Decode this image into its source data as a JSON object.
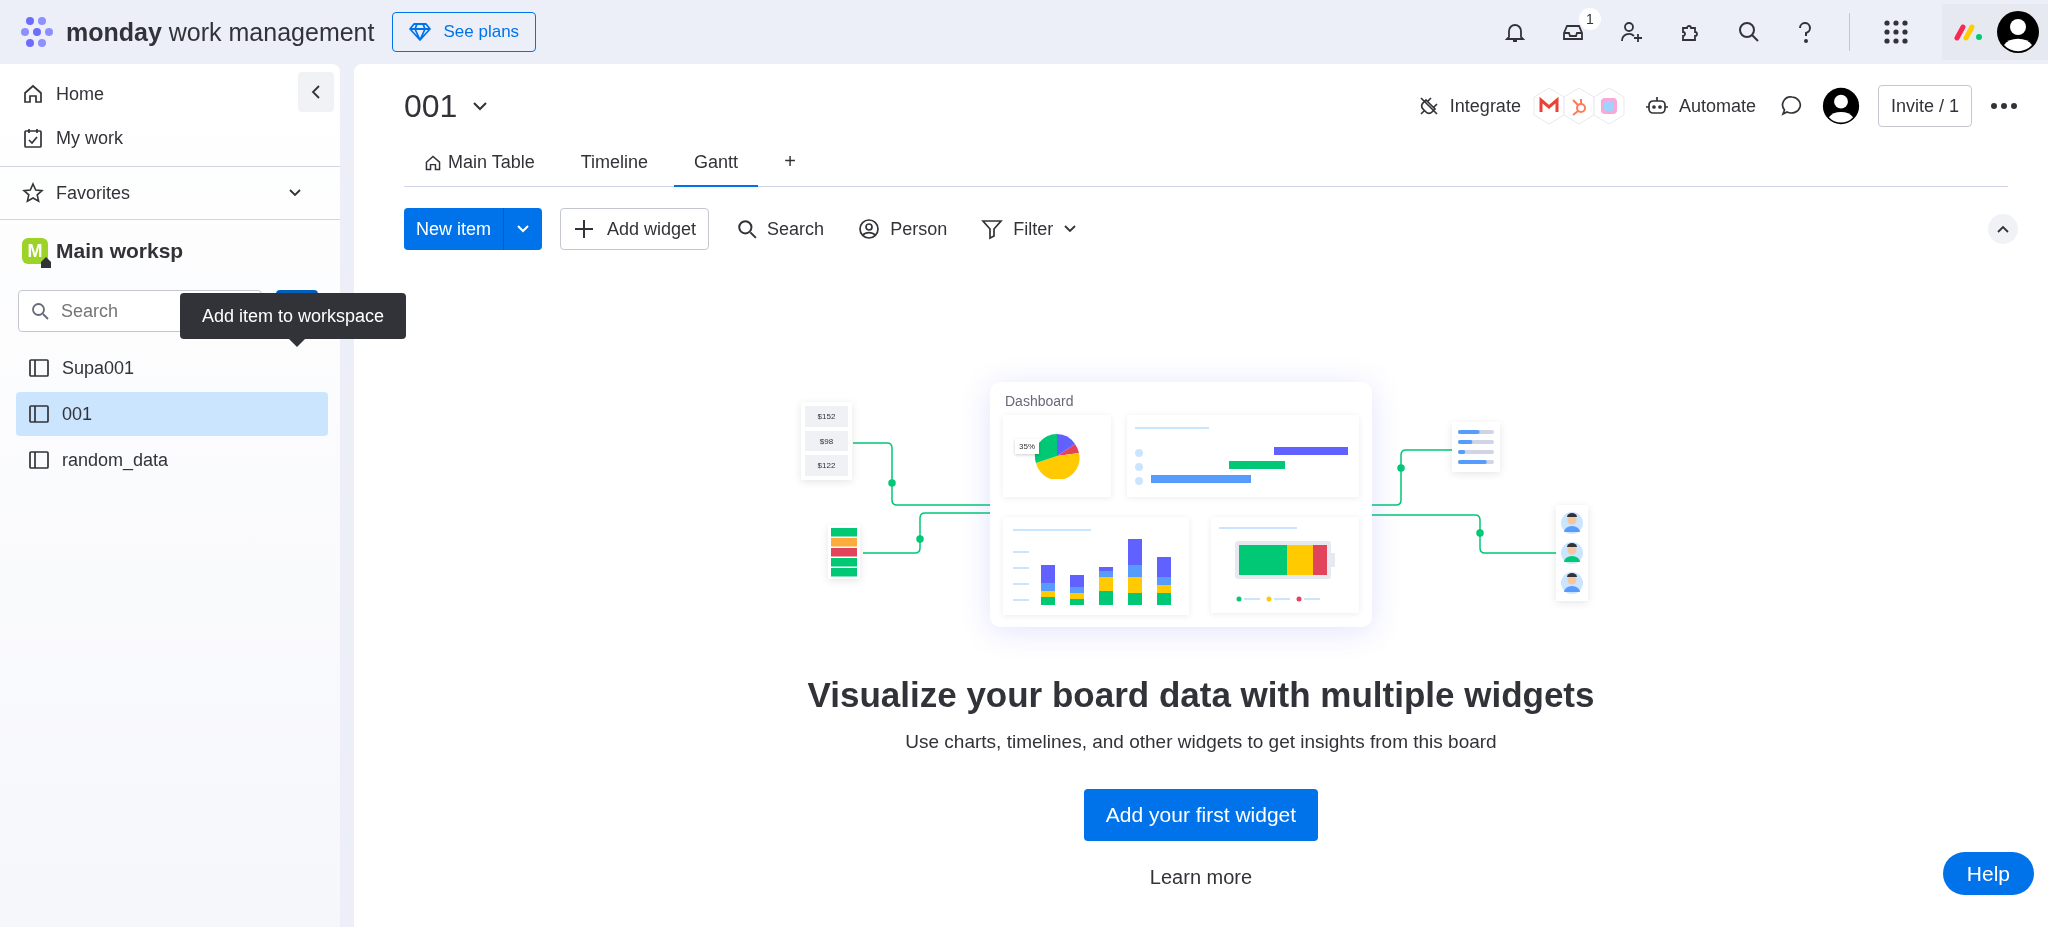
{
  "top_bar": {
    "logo_bold": "monday",
    "logo_rest": "work management",
    "plans_button": "See plans",
    "inbox_badge": "1"
  },
  "sidebar": {
    "nav": [
      {
        "label": "Home",
        "kind": "home"
      },
      {
        "label": "My work",
        "kind": "mywork"
      }
    ],
    "favorites": "Favorites",
    "workspace": {
      "initial": "M",
      "name": "Main worksp"
    },
    "search": {
      "placeholder": "Search"
    },
    "tooltip": "Add item to workspace",
    "boards": [
      {
        "label": "Supa001",
        "selected": false
      },
      {
        "label": "001",
        "selected": true
      },
      {
        "label": "random_data",
        "selected": false
      }
    ]
  },
  "board": {
    "title": "001",
    "integrate": "Integrate",
    "automate": "Automate",
    "invite": "Invite / 1",
    "tabs": [
      {
        "label": "Main Table",
        "selected": false,
        "kind": "home"
      },
      {
        "label": "Timeline",
        "selected": false,
        "kind": "plain"
      },
      {
        "label": "Gantt",
        "selected": true,
        "kind": "plain"
      }
    ],
    "add_tab": "+",
    "toolbar": {
      "new_item": "New item",
      "add_widget": "Add widget",
      "search": "Search",
      "person": "Person",
      "filter": "Filter"
    }
  },
  "empty_state": {
    "illustration": {
      "title": "Dashboard",
      "amounts": [
        "$152",
        "$98",
        "$122"
      ],
      "pie_label": "35%"
    },
    "heading": "Visualize your board data with multiple widgets",
    "text": "Use charts, timelines, and other widgets to get insights from this board",
    "button": "Add your first widget",
    "link": "Learn more"
  },
  "help": "Help"
}
